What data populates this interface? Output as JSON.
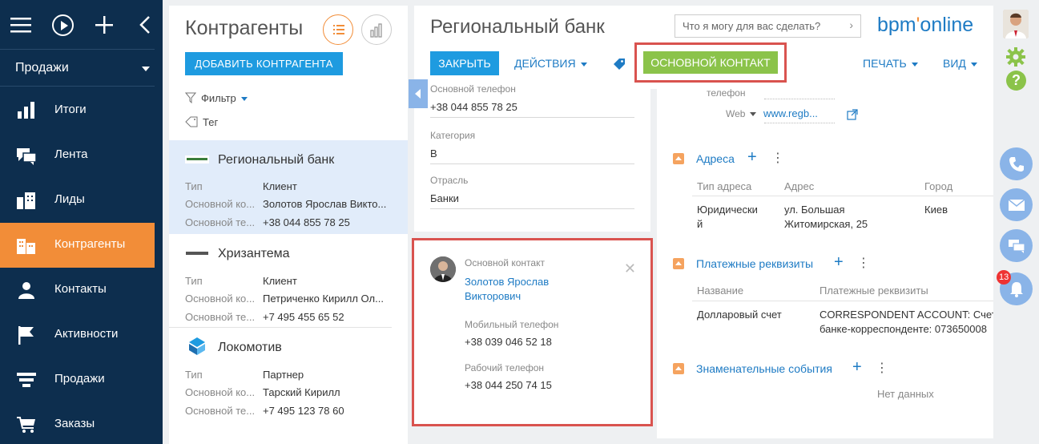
{
  "nav": {
    "workspace": "Продажи",
    "items": [
      {
        "label": "Итоги",
        "icon": "bar-chart-icon"
      },
      {
        "label": "Лента",
        "icon": "feed-icon"
      },
      {
        "label": "Лиды",
        "icon": "leads-icon"
      },
      {
        "label": "Контрагенты",
        "icon": "accounts-icon",
        "active": true
      },
      {
        "label": "Контакты",
        "icon": "contacts-icon"
      },
      {
        "label": "Активности",
        "icon": "flag-icon"
      },
      {
        "label": "Продажи",
        "icon": "funnel-icon"
      },
      {
        "label": "Заказы",
        "icon": "cart-icon"
      }
    ]
  },
  "list": {
    "title": "Контрагенты",
    "add_label": "ДОБАВИТЬ КОНТРАГЕНТА",
    "filter_label": "Фильтр",
    "tag_label": "Тег",
    "cards": [
      {
        "name": "Региональный банк",
        "rows": [
          [
            "Тип",
            "Клиент"
          ],
          [
            "Основной ко...",
            "Золотов Ярослав Викто..."
          ],
          [
            "Основной те...",
            "+38 044 855 78 25"
          ]
        ]
      },
      {
        "name": "Хризантема",
        "rows": [
          [
            "Тип",
            "Клиент"
          ],
          [
            "Основной ко...",
            "Петриченко Кирилл Ол..."
          ],
          [
            "Основной те...",
            "+7 495 455 65 52"
          ]
        ]
      },
      {
        "name": "Локомотив",
        "rows": [
          [
            "Тип",
            "Партнер"
          ],
          [
            "Основной ко...",
            "Тарский Кирилл"
          ],
          [
            "Основной те...",
            "+7 495 123 78 60"
          ]
        ]
      }
    ]
  },
  "header": {
    "title": "Региональный банк",
    "search_placeholder": "Что я могу для вас сделать?",
    "brand_a": "bpm",
    "brand_b": "online",
    "close_label": "ЗАКРЫТЬ",
    "actions_label": "ДЕЙСТВИЯ",
    "main_contact_label": "ОСНОВНОЙ КОНТАКТ",
    "print_label": "ПЕЧАТЬ",
    "view_label": "ВИД"
  },
  "info": {
    "phone_label": "Основной телефон",
    "phone_value": "+38 044 855 78 25",
    "category_label": "Категория",
    "category_value": "B",
    "industry_label": "Отрасль",
    "industry_value": "Банки"
  },
  "contact": {
    "label": "Основной контакт",
    "name_line1": "Золотов Ярослав",
    "name_line2": "Викторович",
    "mobile_label": "Мобильный телефон",
    "mobile_value": "+38 039 046 52 18",
    "work_label": "Рабочий телефон",
    "work_value": "+38 044 250 74 15"
  },
  "detail": {
    "phone_trunc": "телефон",
    "web_label": "Web",
    "web_value": "www.regb...",
    "addresses": {
      "title": "Адреса",
      "cols": [
        "Тип адреса",
        "Адрес",
        "Город"
      ],
      "row": {
        "type_l1": "Юридически",
        "type_l2": "й",
        "addr_l1": "ул. Большая",
        "addr_l2": "Житомирская, 25",
        "city": "Киев"
      }
    },
    "payments": {
      "title": "Платежные реквизиты",
      "cols": [
        "Название",
        "Платежные реквизиты"
      ],
      "row": {
        "name": "Долларовый счет",
        "req_l1": "CORRESPONDENT ACCOUNT: Счет б",
        "req_l2": "банке-корреспонденте: 073650008"
      }
    },
    "events": {
      "title": "Знаменательные события",
      "empty": "Нет данных"
    }
  },
  "notifications_count": "13",
  "colors": {
    "nav_bg": "#0d2e4e",
    "accent": "#f28d38",
    "primary": "#1e9be0",
    "success": "#8bc34a",
    "highlight": "#d9534f"
  }
}
